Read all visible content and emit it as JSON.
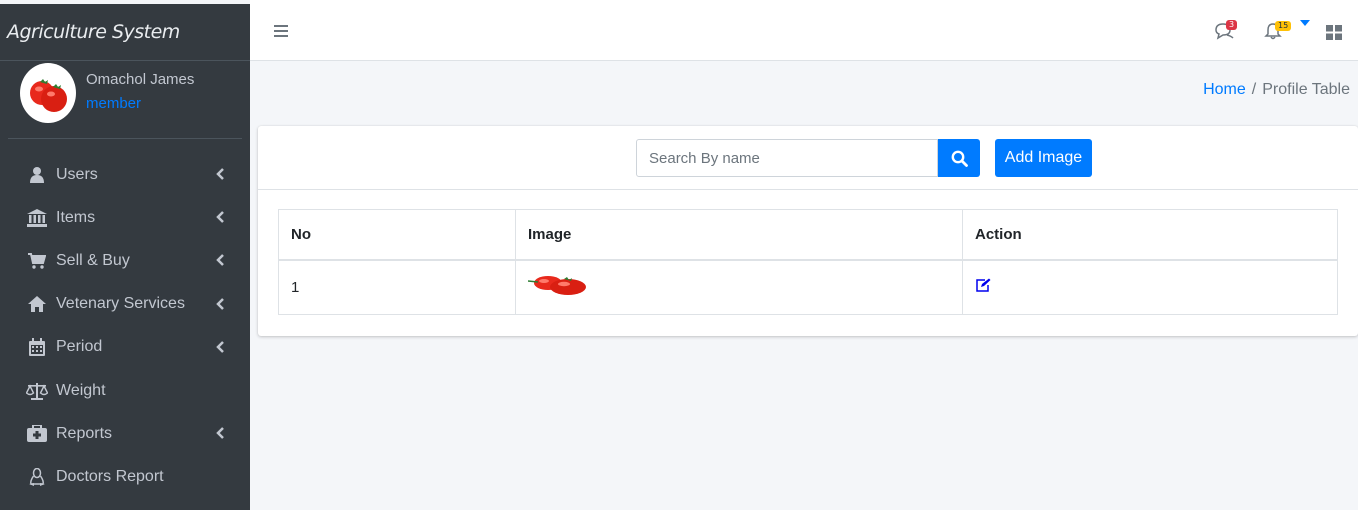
{
  "sidebar": {
    "brand": "Agriculture System",
    "user": {
      "name": "Omachol James",
      "role": "member"
    },
    "items": [
      {
        "label": "Users",
        "icon": "user-icon",
        "has_arrow": true
      },
      {
        "label": "Items",
        "icon": "bank-icon",
        "has_arrow": true
      },
      {
        "label": "Sell & Buy",
        "icon": "cart-icon",
        "has_arrow": true
      },
      {
        "label": "Vetenary Services",
        "icon": "home-icon",
        "has_arrow": true
      },
      {
        "label": "Period",
        "icon": "calendar-icon",
        "has_arrow": true
      },
      {
        "label": "Weight",
        "icon": "balance-scale-icon",
        "has_arrow": false
      },
      {
        "label": "Reports",
        "icon": "medkit-icon",
        "has_arrow": true
      },
      {
        "label": "Doctors Report",
        "icon": "linux-icon",
        "has_arrow": false
      }
    ]
  },
  "topbar": {
    "messages_badge": "3",
    "notifications_badge": "15"
  },
  "breadcrumb": {
    "home": "Home",
    "separator": "/",
    "current": "Profile Table"
  },
  "search": {
    "placeholder": "Search By name",
    "value": ""
  },
  "add_button_label": "Add Image",
  "table": {
    "headers": [
      "No",
      "Image",
      "Action"
    ],
    "rows": [
      {
        "no": "1",
        "image": "tomato-image",
        "action": "edit-icon"
      }
    ]
  },
  "colors": {
    "sidebar_bg": "#343a40",
    "primary": "#007bff",
    "badge_red": "#dc3545",
    "badge_yellow": "#ffc107"
  }
}
